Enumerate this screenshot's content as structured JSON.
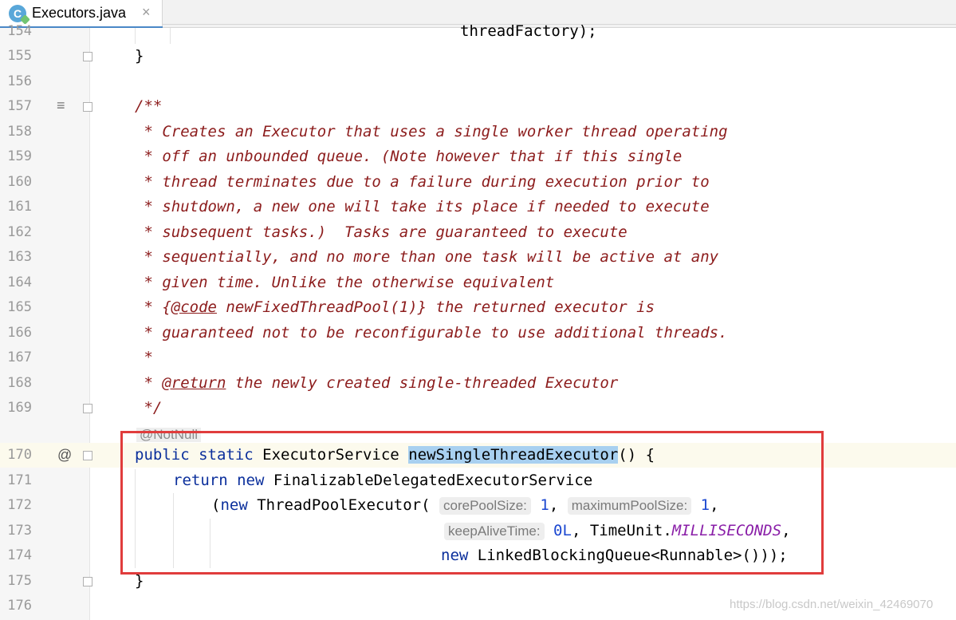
{
  "tab": {
    "icon_letter": "C",
    "title": "Executors.java",
    "close": "×"
  },
  "annotation": "@NotNull",
  "watermark": "https://blog.csdn.net/weixin_42469070",
  "gutter_icons": {
    "doc_icon": "≡",
    "override_icon": "@"
  },
  "lines": {
    "l154": {
      "num": "154",
      "text": "threadFactory);"
    },
    "l155": {
      "num": "155",
      "text": "}"
    },
    "l156": {
      "num": "156"
    },
    "l157": {
      "num": "157",
      "text": "/**"
    },
    "l158": {
      "num": "158",
      "text": " * Creates an Executor that uses a single worker thread operating"
    },
    "l159": {
      "num": "159",
      "text": " * off an unbounded queue. (Note however that if this single"
    },
    "l160": {
      "num": "160",
      "text": " * thread terminates due to a failure during execution prior to"
    },
    "l161": {
      "num": "161",
      "text": " * shutdown, a new one will take its place if needed to execute"
    },
    "l162": {
      "num": "162",
      "text": " * subsequent tasks.)  Tasks are guaranteed to execute"
    },
    "l163": {
      "num": "163",
      "text": " * sequentially, and no more than one task will be active at any"
    },
    "l164": {
      "num": "164",
      "text": " * given time. Unlike the otherwise equivalent"
    },
    "l165": {
      "num": "165",
      "pre": " * {",
      "tag": "@code",
      "post": " newFixedThreadPool(1)} the returned executor is"
    },
    "l166": {
      "num": "166",
      "text": " * guaranteed not to be reconfigurable to use additional threads."
    },
    "l167": {
      "num": "167",
      "text": " *"
    },
    "l168": {
      "num": "168",
      "pre": " * ",
      "tag": "@return",
      "post": " the newly created single-threaded Executor"
    },
    "l169": {
      "num": "169",
      "text": " */"
    },
    "l170": {
      "num": "170",
      "kw1": "public static",
      "type": " ExecutorService ",
      "method": "newSingleThreadExecutor",
      "rest": "() {"
    },
    "l171": {
      "num": "171",
      "kw1": "return new",
      "rest": " FinalizableDelegatedExecutorService"
    },
    "l172": {
      "num": "172",
      "open": "(",
      "kw1": "new",
      "rest": " ThreadPoolExecutor(",
      "hint1": "corePoolSize:",
      "val1": "1",
      "sep": ", ",
      "hint2": "maximumPoolSize:",
      "val2": "1",
      "end": ","
    },
    "l173": {
      "num": "173",
      "hint": "keepAliveTime:",
      "val": "0L",
      "mid": ", TimeUnit.",
      "field": "MILLISECONDS",
      "end": ","
    },
    "l174": {
      "num": "174",
      "kw1": "new",
      "rest": " LinkedBlockingQueue<Runnable>()));"
    },
    "l175": {
      "num": "175",
      "text": "}"
    },
    "l176": {
      "num": "176"
    }
  }
}
